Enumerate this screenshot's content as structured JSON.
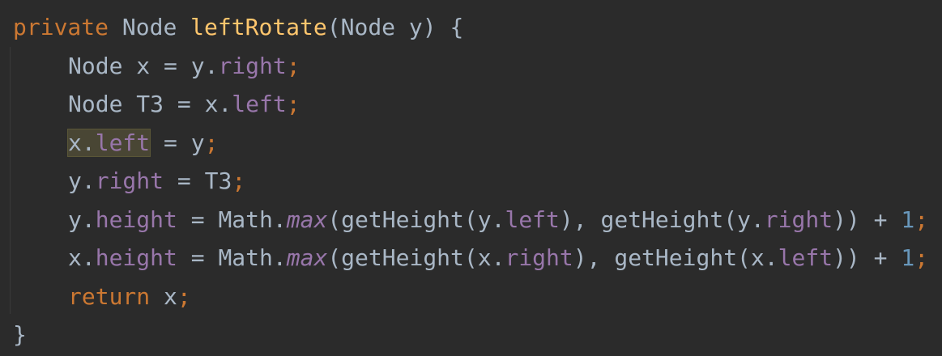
{
  "code": {
    "line1": {
      "kw": "private",
      "type": "Node",
      "method": "leftRotate",
      "rest": "(Node y) {"
    },
    "line2": {
      "a": "Node x = y.",
      "field": "right",
      "semi": ";"
    },
    "line3": {
      "a": "Node T3 = x.",
      "field": "left",
      "semi": ";"
    },
    "line4": {
      "obj": "x.",
      "field": "left",
      "rest": " = y",
      "semi": ";"
    },
    "line5": {
      "a": "y.",
      "field": "right",
      "rest": " = T3",
      "semi": ";"
    },
    "line6": {
      "a": "y.",
      "field1": "height",
      "b": " = Math.",
      "max": "max",
      "c": "(getHeight(y.",
      "field2": "left",
      "d": "), getHeight(y.",
      "field3": "right",
      "e": ")) + ",
      "num": "1",
      "semi": ";"
    },
    "line7": {
      "a": "x.",
      "field1": "height",
      "b": " = Math.",
      "max": "max",
      "c": "(getHeight(x.",
      "field2": "right",
      "d": "), getHeight(x.",
      "field3": "left",
      "e": ")) + ",
      "num": "1",
      "semi": ";"
    },
    "line8": {
      "kw": "return",
      "rest": " x",
      "semi": ";"
    },
    "line9": {
      "brace": "}"
    }
  },
  "colors": {
    "background": "#2b2b2b",
    "default_text": "#a9b7c6",
    "keyword": "#cc7832",
    "method_declaration": "#ffc66d",
    "field": "#9876aa",
    "number": "#6897bb",
    "highlight": "#494634"
  }
}
